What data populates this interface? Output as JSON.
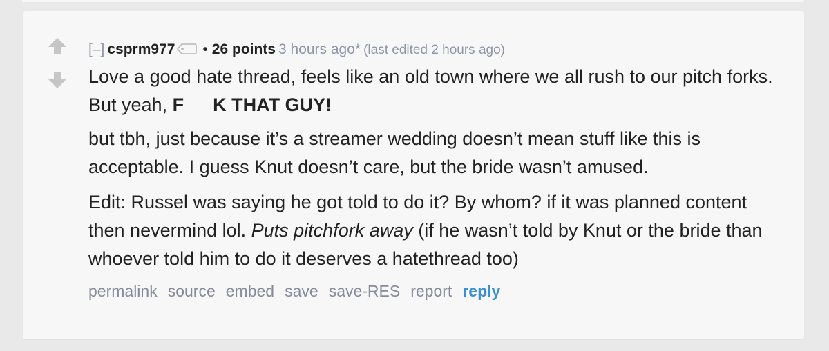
{
  "comment": {
    "expand_label": "[–]",
    "author": "csprm977",
    "bullet": "•",
    "score": "26 points",
    "time": "3 hours ago*",
    "edited": "(last edited 2 hours ago)",
    "paragraph1": {
      "text": "Love a good hate thread, feels like an old town where we all rush to our pitch forks. But yeah, ",
      "bold_start": "F",
      "bold_end": "K THAT GUY!"
    },
    "paragraph2": "but tbh, just because it’s a streamer wedding doesn’t mean stuff like this is acceptable. I guess Knut doesn’t care, but the bride wasn’t amused.",
    "paragraph3": {
      "before": "Edit: Russel was saying he got told to do it? By whom? if it was planned content then nevermind lol. ",
      "italic": "Puts pitchfork away",
      "after": " (if he wasn’t told by Knut or the bride than whoever told him to do it deserves a hatethread too)"
    },
    "buttons": {
      "permalink": "permalink",
      "source": "source",
      "embed": "embed",
      "save": "save",
      "save_res": "save-RES",
      "report": "report",
      "reply": "reply"
    }
  },
  "icons": {
    "upvote": "arrow-up-icon",
    "downvote": "arrow-down-icon",
    "flair": "tag-icon"
  },
  "colors": {
    "background": "#e9e9e9",
    "card": "#f7f7f7",
    "text": "#222222",
    "muted": "#8d96a8",
    "link": "#878a99",
    "reply": "#3a8fd2",
    "arrow": "#c6c6c6"
  }
}
